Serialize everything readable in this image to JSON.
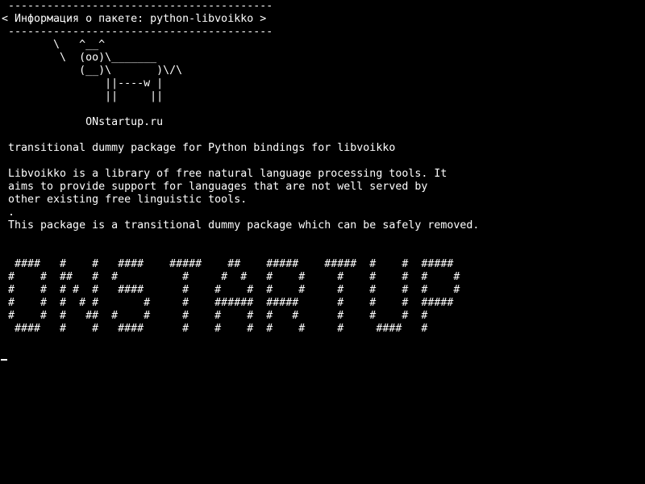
{
  "terminal": {
    "colors": {
      "background": "#000000",
      "foreground": "#ffffff"
    },
    "lines": [
      " -----------------------------------------",
      "< Информация о пакете: python-libvoikko >",
      " -----------------------------------------",
      "        \\   ^__^",
      "         \\  (oo)\\_______",
      "            (__)\\       )\\/\\",
      "                ||----w |",
      "                ||     ||",
      "",
      "             ONstartup.ru",
      "",
      " transitional dummy package for Python bindings for libvoikko",
      "",
      " Libvoikko is a library of free natural language processing tools. It",
      " aims to provide support for languages that are not well served by",
      " other existing free linguistic tools.",
      " .",
      " This package is a transitional dummy package which can be safely removed.",
      "",
      "",
      "  ####   #    #   ####    #####    ##    #####    #####  #    #  #####",
      " #    #  ##   #  #          #     #  #   #    #     #    #    #  #    #",
      " #    #  # #  #   ####      #    #    #  #    #     #    #    #  #    #",
      " #    #  #  # #       #     #    ######  #####      #    #    #  #####",
      " #    #  #   ##  #    #     #    #    #  #   #      #    #    #  #",
      "  ####   #    #   ####      #    #    #  #    #     #     ####   #"
    ],
    "cursor": "_"
  }
}
